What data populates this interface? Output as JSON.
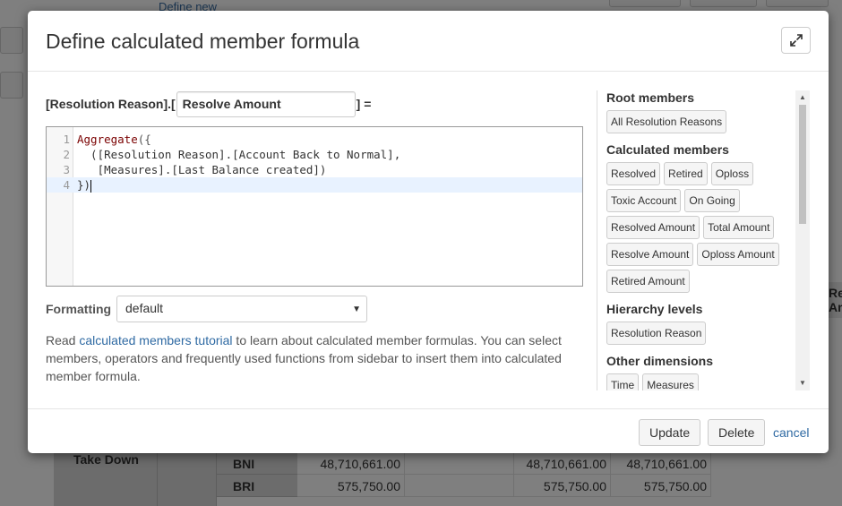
{
  "background": {
    "define_new_link": "Define new",
    "right_col_text": "Re Am",
    "row_header": "Take Down",
    "rows": [
      {
        "name": "BNI",
        "c1": "48,710,661.00",
        "c2": "48,710,661.00",
        "c3": "48,710,661.00"
      },
      {
        "name": "BRI",
        "c1": "575,750.00",
        "c2": "575,750.00",
        "c3": "575,750.00"
      }
    ]
  },
  "dialog": {
    "title": "Define calculated member formula",
    "expand_icon": "expand-arrows-icon",
    "name_prefix": "[Resolution Reason].[",
    "name_value": "Resolve Amount",
    "name_suffix": "] =",
    "editor": {
      "lines": [
        {
          "num": "1",
          "fn": "Aggregate",
          "rest": "({"
        },
        {
          "num": "2",
          "text": "  ([Resolution Reason].[Account Back to Normal],"
        },
        {
          "num": "3",
          "text": "   [Measures].[Last Balance created])"
        },
        {
          "num": "4",
          "text": "})"
        }
      ]
    },
    "formatting_label": "Formatting",
    "formatting_value": "default",
    "help": {
      "prefix": "Read ",
      "link": "calculated members tutorial",
      "suffix": " to learn about calculated member formulas. You can select members, operators and frequently used functions from sidebar to insert them into calculated member formula."
    },
    "sidebar": {
      "root_title": "Root members",
      "root_items": [
        "All Resolution Reasons"
      ],
      "calc_title": "Calculated members",
      "calc_items": [
        "Resolved",
        "Retired",
        "Oploss",
        "Toxic Account",
        "On Going",
        "Resolved Amount",
        "Total Amount",
        "Resolve Amount",
        "Oploss Amount",
        "Retired Amount"
      ],
      "levels_title": "Hierarchy levels",
      "levels_items": [
        "Resolution Reason"
      ],
      "dims_title": "Other dimensions",
      "dims_items": [
        "Time",
        "Measures"
      ]
    },
    "footer": {
      "update": "Update",
      "delete": "Delete",
      "cancel": "cancel"
    }
  }
}
